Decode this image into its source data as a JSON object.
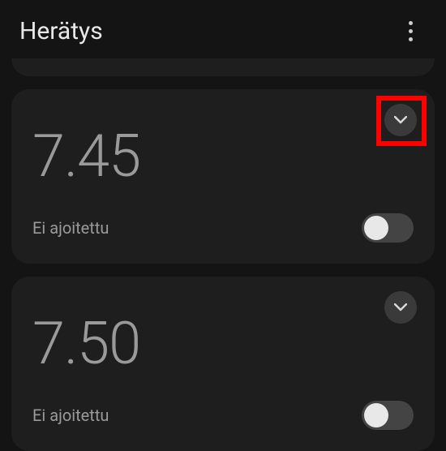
{
  "header": {
    "title": "Herätys"
  },
  "alarms": [
    {
      "time": "7.45",
      "schedule": "Ei ajoitettu",
      "enabled": false,
      "highlighted": true
    },
    {
      "time": "7.50",
      "schedule": "Ei ajoitettu",
      "enabled": false,
      "highlighted": false
    }
  ]
}
